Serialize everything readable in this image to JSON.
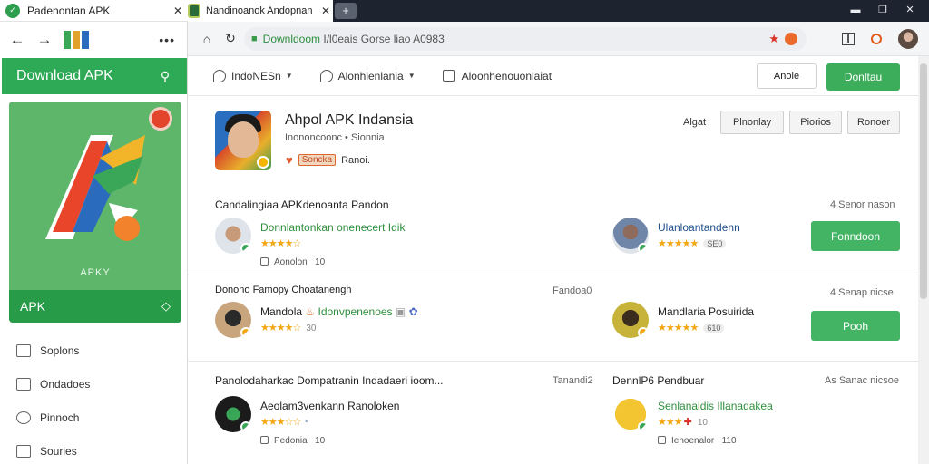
{
  "left_window": {
    "tab_title": "Padenontan APK",
    "nav_more": "•••",
    "header_title": "Download APK",
    "promo": {
      "mid_label": "APKY",
      "bar_label": "APK"
    },
    "menu": [
      {
        "label": "Soplons"
      },
      {
        "label": "Ondadoes"
      },
      {
        "label": "Pinnoch"
      },
      {
        "label": "Souries"
      }
    ]
  },
  "right_window": {
    "tab_title": "Nandinoanok Andopnan",
    "new_tab": "+",
    "url": {
      "host": "Downldoom",
      "path": " I/l0eais Gorse liao A0983"
    },
    "filters": [
      {
        "label": "IndoNESn",
        "caret": "▼"
      },
      {
        "label": "Alonhienlania",
        "caret": "▼"
      },
      {
        "label": "Aloonhenouonlaiat"
      }
    ],
    "sort_select": "Anoie",
    "download_button": "Donltau",
    "app": {
      "title": "Ahpol APK Indansia",
      "subtitle": "Inononcoonc • Sionnia",
      "tag": "Soncka",
      "meta_text": "Ranoi.",
      "actions_label": "Algat",
      "actions": [
        "Plnonlay",
        "Piorios",
        "Ronoer"
      ]
    },
    "sections": [
      {
        "title": "Candalingiaa APKdenoanta Pandon",
        "meta": "4 Senor nason",
        "entries": [
          {
            "name": "Donnlantonkan onenecert Idik",
            "stars": "★★★★☆",
            "info": "Aonolon",
            "info_num": "10"
          },
          {
            "name": "Ulanloantandenn",
            "stars": "★★★★★",
            "pill": "SE0"
          }
        ],
        "button": "Fonndoon"
      },
      {
        "title": "Donono Famopy Choatanengh",
        "meta_mid": "Fandoa0",
        "meta": "4 Senap nicse",
        "entries": [
          {
            "name": "Mandola",
            "name_extra": "Idonvpenenoes",
            "stars": "★★★★☆",
            "cnt": "30"
          },
          {
            "name": "Mandlaria Posuirida",
            "stars": "★★★★★",
            "pill": "610"
          }
        ],
        "button": "Pooh"
      },
      {
        "title": "Panolodaharkac Dompatranin Indadaeri ioom...",
        "meta_mid": "Tanandi2",
        "col2_title": "DennlP6 Pendbuar",
        "meta": "As Sanac nicsoe",
        "entries": [
          {
            "name": "Aeolam3venkann Ranoloken",
            "stars": "★★★☆☆",
            "info": "Pedonia",
            "info_num": "10"
          },
          {
            "name": "Senlanaldis Illanadakea",
            "stars": "★★★",
            "cnt": "10",
            "info": "Ienoenalor",
            "info_num": "110"
          }
        ]
      }
    ]
  }
}
